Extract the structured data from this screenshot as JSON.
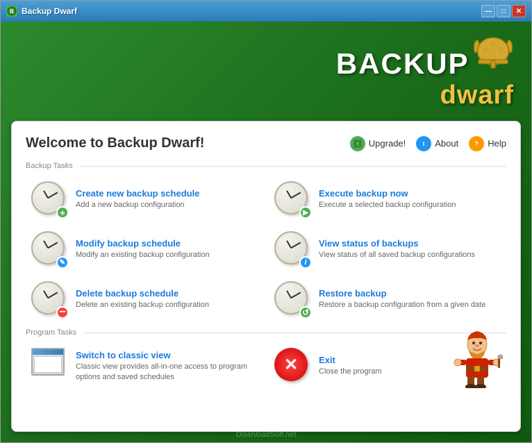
{
  "window": {
    "title": "Backup Dwarf",
    "controls": {
      "minimize": "—",
      "maximize": "□",
      "close": "✕"
    }
  },
  "header": {
    "welcome": "Welcome to Backup Dwarf!",
    "upgrade_label": "Upgrade!",
    "about_label": "About",
    "help_label": "Help"
  },
  "sections": {
    "backup_tasks_label": "Backup Tasks",
    "program_tasks_label": "Program Tasks"
  },
  "backup_tasks": [
    {
      "title": "Create new backup schedule",
      "desc": "Add a new backup configuration",
      "badge_type": "green",
      "badge_symbol": "+"
    },
    {
      "title": "Execute backup now",
      "desc": "Execute a selected backup configuration",
      "badge_type": "green",
      "badge_symbol": "▶"
    },
    {
      "title": "Modify backup schedule",
      "desc": "Modify an existing backup configuration",
      "badge_type": "blue",
      "badge_symbol": "✎"
    },
    {
      "title": "View status of backups",
      "desc": "View status of all saved backup configurations",
      "badge_type": "blue",
      "badge_symbol": "i"
    },
    {
      "title": "Delete backup schedule",
      "desc": "Delete an existing backup configuration",
      "badge_type": "red",
      "badge_symbol": "−"
    },
    {
      "title": "Restore backup",
      "desc": "Restore a backup configuration from a given date",
      "badge_type": "green",
      "badge_symbol": "↺"
    }
  ],
  "program_tasks": [
    {
      "title": "Switch to classic view",
      "desc": "Classic view provides all-in-one access to program options and saved schedules",
      "type": "classic"
    },
    {
      "title": "Exit",
      "desc": "Close the program",
      "type": "exit"
    }
  ],
  "watermark": "DownloadSoft.net",
  "logo": {
    "backup": "BACKUP",
    "dwarf": "dwarf"
  }
}
